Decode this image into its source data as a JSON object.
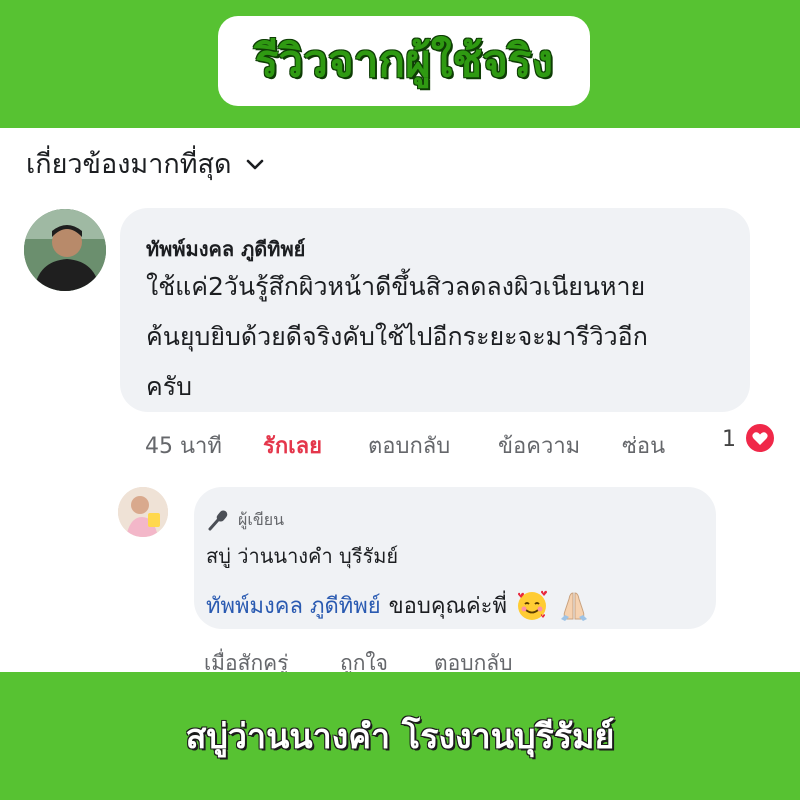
{
  "header": {
    "title": "รีวิวจากผู้ใช้จริง"
  },
  "sort": {
    "label": "เกี่ยวข้องมากที่สุด"
  },
  "comment": {
    "author": "ทัพพ์มงคล ภูดีทิพย์",
    "lines": [
      "ใช้แค่2วันรู้สึกผิวหน้าดีขึ้นสิวลดลงผิวเนียนหาย",
      "ค้นยุบยิบด้วยดีจริงคับใช้ไปอีกระยะจะมารีวิวอีก",
      "ครับ"
    ],
    "time": "45 นาที",
    "like": "รักเลย",
    "reply": "ตอบกลับ",
    "message": "ข้อความ",
    "hide": "ซ่อน",
    "reaction_count": "1"
  },
  "reply": {
    "author_label": "ผู้เขียน",
    "author": "สบู่ ว่านนางคำ บุรีรัมย์",
    "mention": "ทัพพ์มงคล ภูดีทิพย์",
    "text": "ขอบคุณค่ะพี่",
    "time": "เมื่อสักครู่",
    "like": "ถูกใจ",
    "reply": "ตอบกลับ"
  },
  "footer": {
    "text": "สบู่ว่านนางคำ โรงงานบุรีรัมย์"
  },
  "colors": {
    "band": "#57c232",
    "title": "#2f9a12",
    "like": "#e4364b",
    "mention": "#2a5ab1",
    "bubble": "#f0f2f5"
  },
  "icons": [
    "chevron-down-icon",
    "heart-icon",
    "microphone-icon",
    "smiling-face-with-hearts-icon",
    "folded-hands-icon"
  ]
}
